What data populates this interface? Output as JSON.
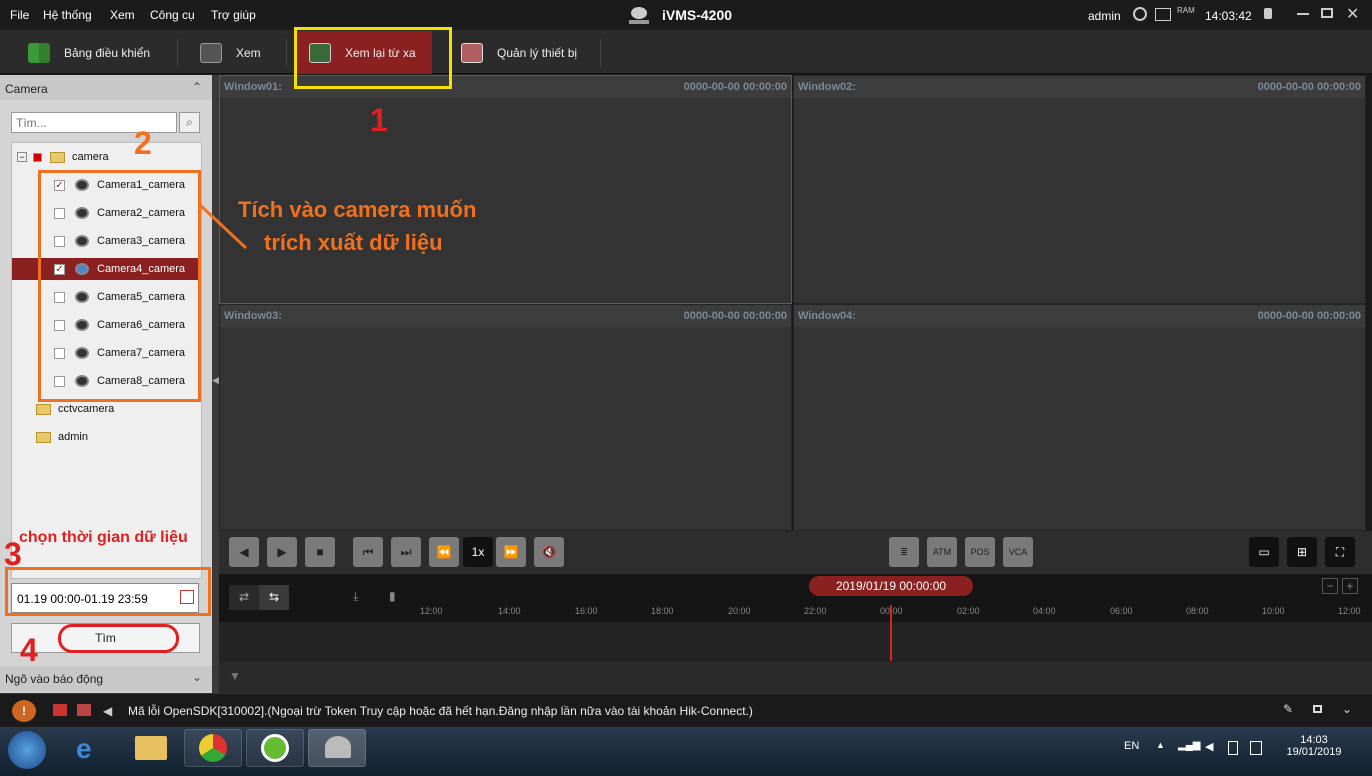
{
  "menu": {
    "file": "File",
    "system": "Hệ thống",
    "view": "Xem",
    "tools": "Công cụ",
    "help": "Trợ giúp"
  },
  "app_title": "iVMS-4200",
  "topbar": {
    "user": "admin",
    "time": "14:03:42",
    "ram": "RAM"
  },
  "nav": {
    "dashboard": "Bảng điều khiển",
    "view": "Xem",
    "remote_playback": "Xem lại từ xa",
    "device_mgmt": "Quản lý thiết bị"
  },
  "left": {
    "camera_header": "Camera",
    "search_placeholder": "Tìm...",
    "tree": [
      {
        "label": "camera",
        "type": "group",
        "checked": false
      },
      {
        "label": "Camera1_camera",
        "type": "camera",
        "checked": true
      },
      {
        "label": "Camera2_camera",
        "type": "camera",
        "checked": false
      },
      {
        "label": "Camera3_camera",
        "type": "camera",
        "checked": false
      },
      {
        "label": "Camera4_camera",
        "type": "camera",
        "checked": true,
        "selected": true
      },
      {
        "label": "Camera5_camera",
        "type": "camera",
        "checked": false
      },
      {
        "label": "Camera6_camera",
        "type": "camera",
        "checked": false
      },
      {
        "label": "Camera7_camera",
        "type": "camera",
        "checked": false
      },
      {
        "label": "Camera8_camera",
        "type": "camera",
        "checked": false
      },
      {
        "label": "cctvcamera",
        "type": "folder"
      },
      {
        "label": "admin",
        "type": "folder"
      }
    ],
    "date_range": "01.19 00:00-01.19 23:59",
    "search_button": "Tìm",
    "alarm_header": "Ngõ vào báo động"
  },
  "windows": [
    {
      "name": "Window01:",
      "time": "0000-00-00 00:00:00"
    },
    {
      "name": "Window02:",
      "time": "0000-00-00 00:00:00"
    },
    {
      "name": "Window03:",
      "time": "0000-00-00 00:00:00"
    },
    {
      "name": "Window04:",
      "time": "0000-00-00 00:00:00"
    }
  ],
  "controls": {
    "speed": "1x",
    "atm": "ATM",
    "pos": "POS",
    "vca": "VCA"
  },
  "timeline": {
    "date": "2019/01/19 00:00:00",
    "ticks": [
      "12:00",
      "14:00",
      "16:00",
      "18:00",
      "20:00",
      "22:00",
      "00:00",
      "02:00",
      "04:00",
      "06:00",
      "08:00",
      "10:00",
      "12:00"
    ]
  },
  "status": {
    "message": "Mã lỗi OpenSDK[310002].(Ngoại trừ Token Truy cập hoặc đã hết hạn.Đăng nhập lần nữa vào tài khoản Hik-Connect.)"
  },
  "taskbar": {
    "lang": "EN",
    "time": "14:03",
    "date": "19/01/2019"
  },
  "annotations": {
    "n1": "1",
    "n2": "2",
    "n3": "3",
    "n4": "4",
    "hint_line1": "Tích vào camera muốn",
    "hint_line2": "trích xuất dữ liệu",
    "time_hint": "chọn thời gian dữ liệu",
    "color_yellow": "#f5e100",
    "color_orange": "#f07020",
    "color_red": "#e02020"
  }
}
